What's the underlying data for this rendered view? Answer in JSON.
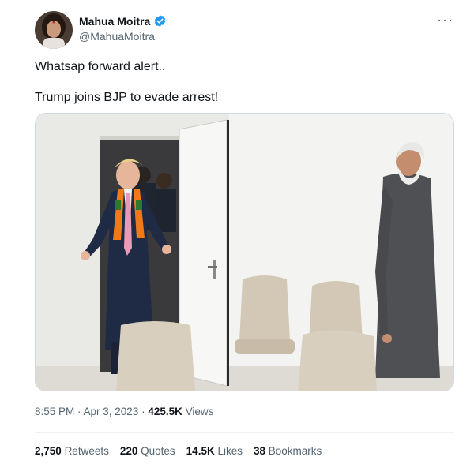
{
  "author": {
    "display_name": "Mahua Moitra",
    "handle": "@MahuaMoitra"
  },
  "tweet": {
    "line1": "Whatsap forward alert..",
    "line2": "Trump joins BJP to evade arrest!"
  },
  "meta": {
    "timestamp": "8:55 PM · Apr 3, 2023",
    "separator": " · ",
    "views_count": "425.5K",
    "views_label": "Views"
  },
  "stats": {
    "retweets_count": "2,750",
    "retweets_label": "Retweets",
    "quotes_count": "220",
    "quotes_label": "Quotes",
    "likes_count": "14.5K",
    "likes_label": "Likes",
    "bookmarks_count": "38",
    "bookmarks_label": "Bookmarks"
  },
  "icons": {
    "verified": "verified-badge-icon",
    "more": "more-options-icon"
  },
  "colors": {
    "verified_blue": "#1d9bf0",
    "secondary_text": "#536471",
    "primary_text": "#0f1419"
  }
}
